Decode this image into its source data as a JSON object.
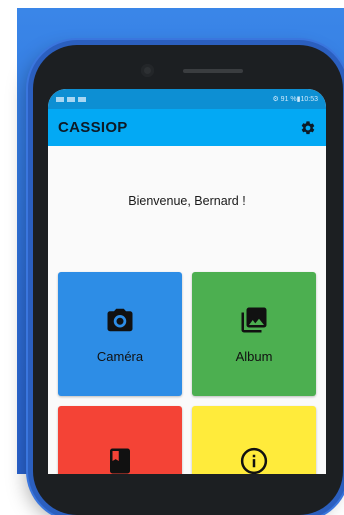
{
  "colors": {
    "appbar": "#03a9f4",
    "camera_tile": "#2d8de6",
    "album_tile": "#4caf50",
    "book_tile": "#f44336",
    "info_tile": "#ffeb3b"
  },
  "statusbar": {
    "right_text": "⚙ 91 %▮10:53"
  },
  "appbar": {
    "title": "CASSIOP",
    "settings_icon": "gear-icon"
  },
  "main": {
    "welcome": "Bienvenue, Bernard !",
    "tiles": [
      {
        "label": "Caméra",
        "icon": "camera-icon"
      },
      {
        "label": "Album",
        "icon": "photo-album-icon"
      },
      {
        "label": "",
        "icon": "book-icon"
      },
      {
        "label": "",
        "icon": "info-icon"
      }
    ]
  }
}
